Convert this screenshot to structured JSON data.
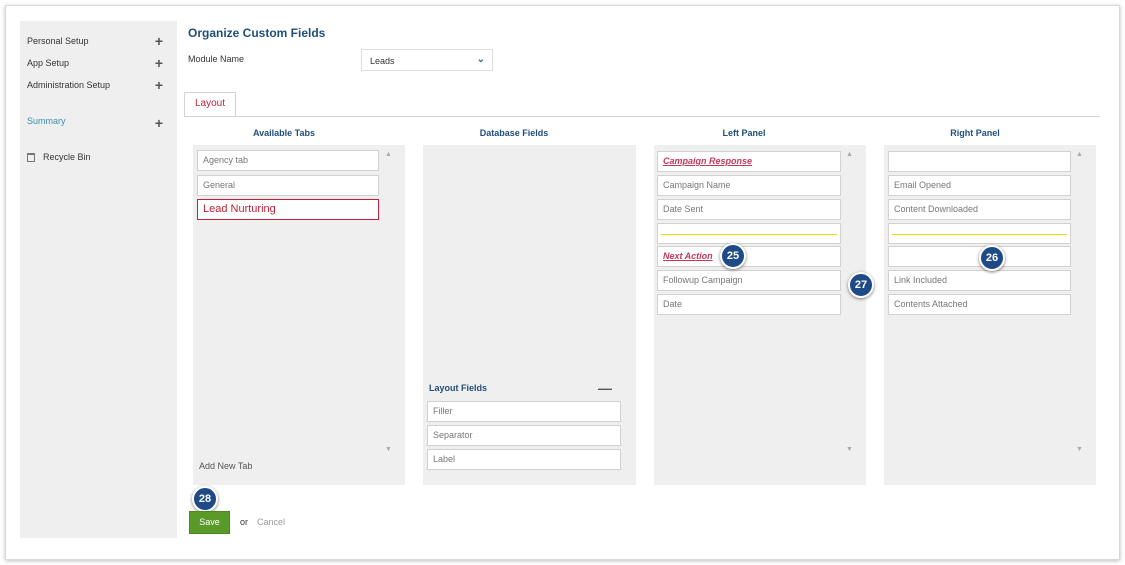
{
  "sidebar": {
    "items": [
      {
        "label": "Personal Setup"
      },
      {
        "label": "App Setup"
      },
      {
        "label": "Administration Setup"
      },
      {
        "label": "Summary"
      }
    ],
    "recycle_bin": "Recycle Bin"
  },
  "page_title": "Organize Custom Fields",
  "module": {
    "label": "Module Name",
    "value": "Leads"
  },
  "tabs": [
    {
      "label": "Layout"
    }
  ],
  "columns": {
    "available_tabs": {
      "title": "Available Tabs",
      "items": [
        "Agency tab",
        "General",
        "Lead Nurturing"
      ],
      "add_label": "Add New Tab"
    },
    "database_fields": {
      "title": "Database Fields",
      "layout_fields_title": "Layout Fields",
      "layout_fields": [
        "Filler",
        "Separator",
        "Label"
      ]
    },
    "left_panel": {
      "title": "Left Panel",
      "items": [
        "Campaign Response",
        "Campaign Name",
        "Date Sent",
        "",
        "Next Action",
        "Followup Campaign",
        "Date"
      ]
    },
    "right_panel": {
      "title": "Right Panel",
      "items": [
        "",
        "Email Opened",
        "Content Downloaded",
        "",
        "",
        "Link Included",
        "Contents Attached"
      ]
    }
  },
  "badges": [
    "25",
    "26",
    "27",
    "28"
  ],
  "actions": {
    "save": "Save",
    "or": "or",
    "cancel": "Cancel"
  },
  "colors": {
    "title": "#1f4e79",
    "selected": "#c0213a",
    "save": "#5a9a28",
    "badge": "#1e4a87",
    "separator": "#e8e000"
  }
}
